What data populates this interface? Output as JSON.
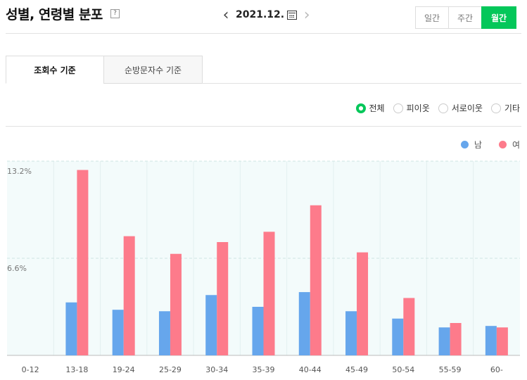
{
  "header": {
    "title": "성별, 연령별 분포",
    "help_label": "?",
    "date": "2021.12.",
    "periods": [
      "일간",
      "주간",
      "월간"
    ],
    "active_period": "월간"
  },
  "tabs": [
    "조회수 기준",
    "순방문자수 기준"
  ],
  "filters": {
    "options": [
      "전체",
      "피이옷",
      "서로이웃",
      "기타"
    ],
    "selected": "전체"
  },
  "colors": {
    "accent": "#04c75a",
    "male": "#66a6ec",
    "female": "#fd7b8b"
  },
  "chart_data": {
    "type": "bar",
    "categories": [
      "0-12",
      "13-18",
      "19-24",
      "25-29",
      "30-34",
      "35-39",
      "40-44",
      "45-49",
      "50-54",
      "55-59",
      "60-"
    ],
    "series": [
      {
        "name": "남",
        "values": [
          0.0,
          3.6,
          3.1,
          3.0,
          4.1,
          3.3,
          4.3,
          3.0,
          2.5,
          1.9,
          2.0
        ]
      },
      {
        "name": "여",
        "values": [
          0.0,
          12.6,
          8.1,
          6.9,
          7.7,
          8.4,
          10.2,
          7.0,
          3.9,
          2.2,
          1.9
        ]
      }
    ],
    "ytick_labels": [
      "13.2%",
      "6.6%"
    ],
    "yticks": [
      13.2,
      6.6
    ],
    "ylim": [
      0,
      13.2
    ],
    "grid": true,
    "legend_position": "top-right"
  }
}
